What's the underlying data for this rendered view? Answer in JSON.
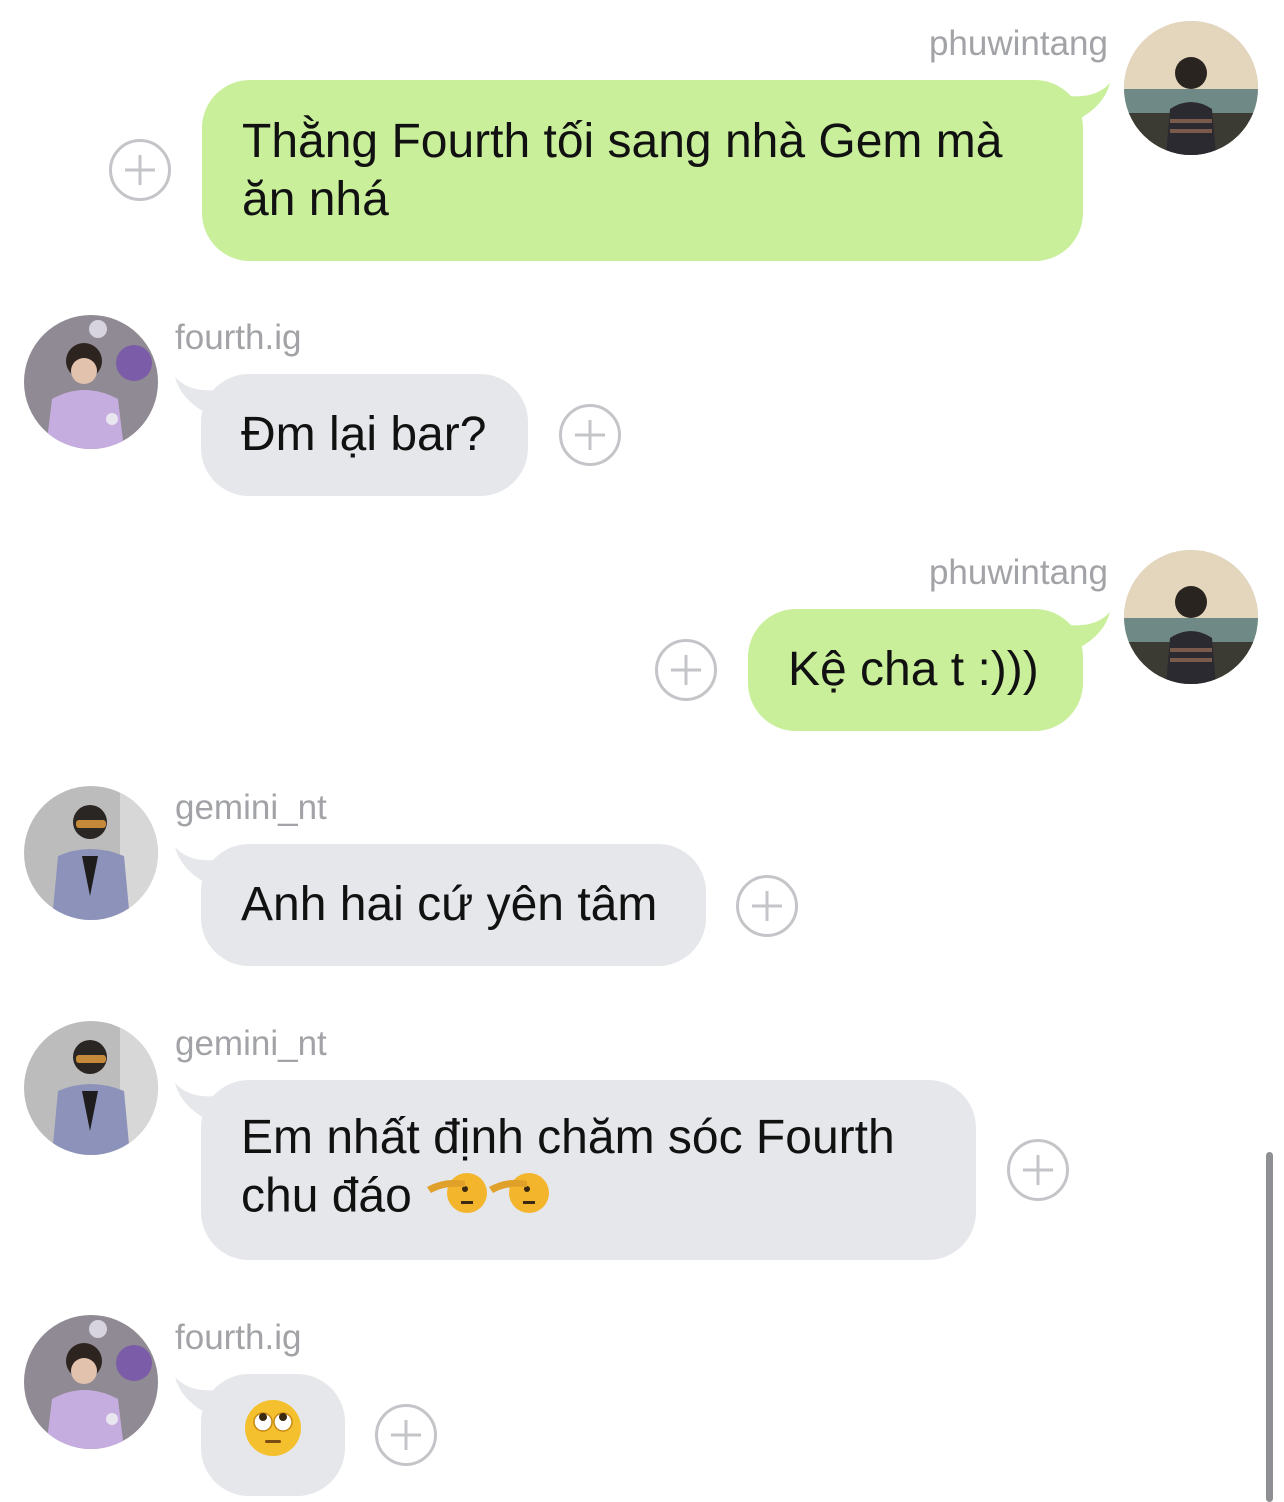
{
  "messages": [
    {
      "sender": "phuwintang",
      "text": "Thằng Fourth tối sang nhà Gem mà\năn nhá",
      "avatar_icon": "phuwin-avatar"
    },
    {
      "sender": "fourth.ig",
      "text": "Đm lại bar?",
      "avatar_icon": "fourth-avatar"
    },
    {
      "sender": "phuwintang",
      "text": "Kệ cha t :)))",
      "avatar_icon": "phuwin-avatar"
    },
    {
      "sender": "gemini_nt",
      "text": "Anh hai cứ yên tâm",
      "avatar_icon": "gemini-avatar"
    },
    {
      "sender": "gemini_nt",
      "text": "Em nhất định chăm sóc Fourth\nchu đáo ",
      "emoji": "saluting-face-icon x2",
      "avatar_icon": "gemini-avatar"
    },
    {
      "sender": "fourth.ig",
      "emoji": "face-with-rolling-eyes-icon",
      "avatar_icon": "fourth-avatar"
    }
  ],
  "colors": {
    "outgoing_bubble": "#c9ef9b",
    "incoming_bubble": "#e5e7ea",
    "username": "#a2a3a6",
    "react_button": "#c4c5c8"
  }
}
